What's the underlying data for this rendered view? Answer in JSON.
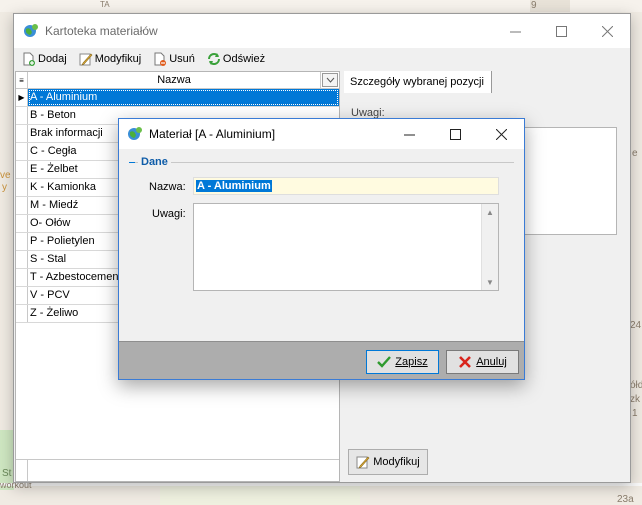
{
  "main_window": {
    "title": "Kartoteka materiałów",
    "toolbar": {
      "add": "Dodaj",
      "modify": "Modyfikuj",
      "delete": "Usuń",
      "refresh": "Odśwież"
    },
    "grid": {
      "column_header": "Nazwa",
      "rows": [
        "A - Aluminium",
        "B - Beton",
        "Brak informacji",
        "C - Cegła",
        "E - Żelbet",
        "K - Kamionka",
        "M - Miedź",
        "O- Ołów",
        "P - Polietylen",
        "S - Stal",
        "T - Azbestocement",
        "V - PCV",
        "Z - Żeliwo"
      ]
    },
    "details": {
      "tab_label": "Szczegóły wybranej pozycji",
      "uwagi_label": "Uwagi:",
      "modify_button": "Modyfikuj"
    }
  },
  "dialog": {
    "title": "Materiał [A - Aluminium]",
    "group_title": "Dane",
    "nazwa_label": "Nazwa:",
    "nazwa_value": "A - Aluminium",
    "uwagi_label": "Uwagi:",
    "save_button": "Zapisz",
    "cancel_button": "Anuluj"
  },
  "map": {
    "labels": [
      "9",
      "TA",
      "ve",
      "y",
      "St",
      "24",
      "ółd",
      "zk",
      "1",
      "23a",
      "workout",
      "e"
    ]
  },
  "colors": {
    "selection": "#0078d7",
    "input_highlight": "#fffbe0",
    "group_title": "#0e5ca8",
    "cancel_icon": "#d9241c",
    "save_icon": "#2e9a2e"
  }
}
